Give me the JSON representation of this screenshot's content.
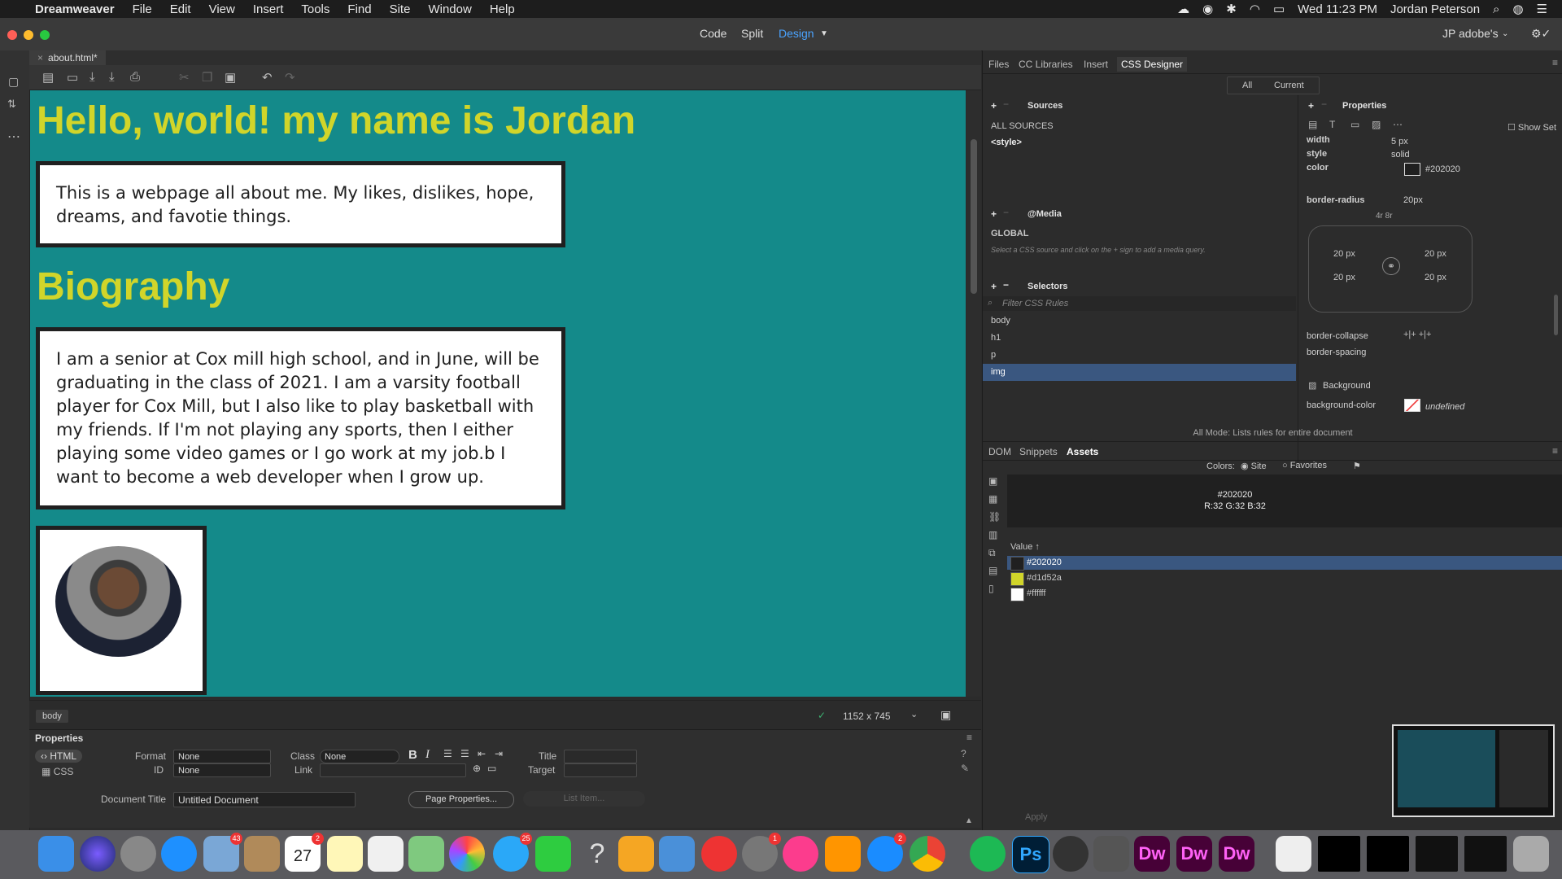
{
  "menubar": {
    "app_name": "Dreamweaver",
    "items": [
      "File",
      "Edit",
      "View",
      "Insert",
      "Tools",
      "Find",
      "Site",
      "Window",
      "Help"
    ],
    "clock": "Wed 11:23 PM",
    "user": "Jordan Peterson"
  },
  "titlebar": {
    "modes": [
      "Code",
      "Split",
      "Design"
    ],
    "active_mode": "Design",
    "workspace": "JP adobe's"
  },
  "document": {
    "tab_name": "about.html*",
    "h1_1": "Hello, world! my name is Jordan",
    "p1": "This is a webpage all about me. My likes, dislikes, hope, dreams, and favotie things.",
    "h1_2": "Biography",
    "p2": "I am a senior at Cox mill high school, and in June, will be graduating in the class of 2021. I am a varsity football player for Cox Mill, but I also like to play basketball with my friends. If I'm not playing any sports, then I either playing some video games or I go work at my job.b I want to become a web developer when I grow up."
  },
  "statusbar": {
    "tag": "body",
    "size": "1152 x 745"
  },
  "properties": {
    "title": "Properties",
    "html_label": "HTML",
    "css_label": "CSS",
    "format_label": "Format",
    "format_value": "None",
    "class_label": "Class",
    "class_value": "None",
    "id_label": "ID",
    "id_value": "None",
    "link_label": "Link",
    "title_label": "Title",
    "target_label": "Target",
    "doc_title_label": "Document Title",
    "doc_title_value": "Untitled Document",
    "page_props_button": "Page Properties...",
    "list_item_button": "List Item..."
  },
  "right_tabs": [
    "Files",
    "CC Libraries",
    "Insert",
    "CSS Designer"
  ],
  "css_designer": {
    "all_label": "All",
    "current_label": "Current",
    "sources_title": "Sources",
    "all_sources": "ALL SOURCES",
    "style_source": "<style>",
    "media_title": "@Media",
    "global": "GLOBAL",
    "media_hint": "Select a CSS source and click on the + sign to add a media query.",
    "selectors_title": "Selectors",
    "filter_placeholder": "Filter CSS Rules",
    "selectors": [
      "body",
      "h1",
      "p",
      "img"
    ],
    "active_selector": "img",
    "properties_title": "Properties",
    "show_set": "Show Set",
    "footer": "All Mode: Lists rules for entire document",
    "props": {
      "width_label": "width",
      "width_value": "5 px",
      "style_label": "style",
      "style_value": "solid",
      "color_label": "color",
      "color_value": "#202020",
      "radius_label": "border-radius",
      "radius_value": "20px",
      "radius_mode": "4r  8r",
      "corner_tl": "20 px",
      "corner_tr": "20 px",
      "corner_bl": "20 px",
      "corner_br": "20 px",
      "collapse_label": "border-collapse",
      "spacing_label": "border-spacing",
      "background_title": "Background",
      "bgcolor_label": "background-color",
      "bgcolor_value": "undefined"
    }
  },
  "lower_tabs": [
    "DOM",
    "Snippets",
    "Assets"
  ],
  "assets": {
    "colors_label": "Colors:",
    "site_label": "Site",
    "favorites_label": "Favorites",
    "preview_hex": "#202020",
    "preview_rgb": "R:32 G:32 B:32",
    "value_header": "Value",
    "colors": [
      {
        "hex": "#202020",
        "swatch": "#202020"
      },
      {
        "hex": "#d1d52a",
        "swatch": "#d1d52a"
      },
      {
        "hex": "#ffffff",
        "swatch": "#ffffff"
      }
    ],
    "apply_button": "Apply"
  },
  "dock": {
    "calendar_day": "27",
    "calendar_month": "JAN",
    "badges": {
      "mail": "43",
      "calendar": "2",
      "messages": "25",
      "prefs": "1",
      "appstore": "2"
    },
    "dw_label": "Dw",
    "ps_label": "Ps"
  },
  "colors": {
    "canvas_bg": "#148a8a",
    "heading": "#d1d52a",
    "border": "#202020",
    "accent": "#3b8ded"
  }
}
